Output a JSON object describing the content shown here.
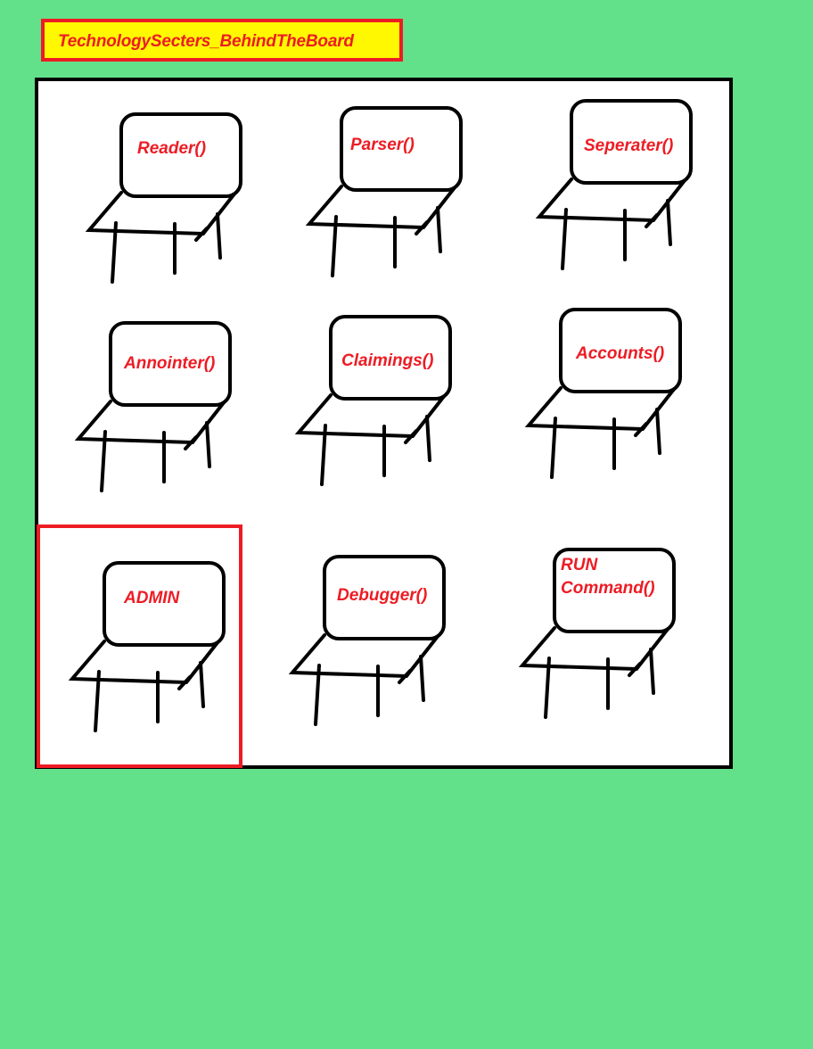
{
  "title": "TechnologySecters_BehindTheBoard",
  "colors": {
    "background": "#63e08a",
    "title_fill": "#fff800",
    "accent_red": "#ed1c24",
    "board_fill": "#ffffff",
    "line": "#000000"
  },
  "highlighted_chair": "ADMIN",
  "chairs": [
    {
      "id": "reader",
      "label_lines": [
        "Reader()"
      ]
    },
    {
      "id": "parser",
      "label_lines": [
        "Parser()"
      ]
    },
    {
      "id": "seperater",
      "label_lines": [
        "Seperater()"
      ]
    },
    {
      "id": "annointer",
      "label_lines": [
        "Annointer()"
      ]
    },
    {
      "id": "claimings",
      "label_lines": [
        "Claimings()"
      ]
    },
    {
      "id": "accounts",
      "label_lines": [
        "Accounts()"
      ]
    },
    {
      "id": "admin",
      "label_lines": [
        "ADMIN"
      ]
    },
    {
      "id": "debugger",
      "label_lines": [
        "Debugger()"
      ]
    },
    {
      "id": "run-command",
      "label_lines": [
        "RUN",
        "Command()"
      ]
    }
  ]
}
